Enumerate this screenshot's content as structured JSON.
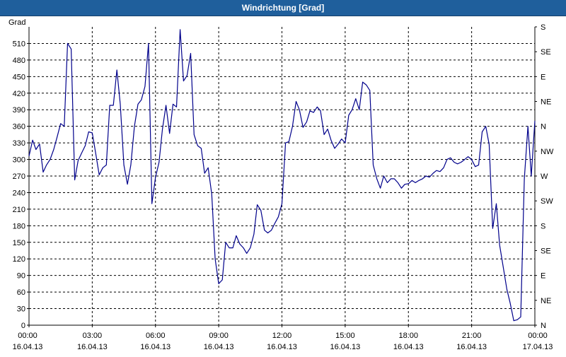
{
  "window": {
    "title": "Windrichtung [Grad]"
  },
  "colors": {
    "titlebar": "#1f5f9c",
    "line": "#00008b",
    "grid": "#000000"
  },
  "chart_data": {
    "type": "line",
    "title": "Windrichtung [Grad]",
    "ylabel": "Grad",
    "ylim": [
      0,
      540
    ],
    "xlim_hours": [
      0,
      24
    ],
    "grid": true,
    "y_ticks": [
      0,
      30,
      60,
      90,
      120,
      150,
      180,
      210,
      240,
      270,
      300,
      330,
      360,
      390,
      420,
      450,
      480,
      510
    ],
    "x_ticks": [
      {
        "hour": 0,
        "time": "00:00",
        "date": "16.04.13"
      },
      {
        "hour": 3,
        "time": "03:00",
        "date": "16.04.13"
      },
      {
        "hour": 6,
        "time": "06:00",
        "date": "16.04.13"
      },
      {
        "hour": 9,
        "time": "09:00",
        "date": "16.04.13"
      },
      {
        "hour": 12,
        "time": "12:00",
        "date": "16.04.13"
      },
      {
        "hour": 15,
        "time": "15:00",
        "date": "16.04.13"
      },
      {
        "hour": 18,
        "time": "18:00",
        "date": "16.04.13"
      },
      {
        "hour": 21,
        "time": "21:00",
        "date": "16.04.13"
      },
      {
        "hour": 24,
        "time": "00:00",
        "date": "17.04.13"
      }
    ],
    "right_axis": [
      {
        "value": 0,
        "label": "N"
      },
      {
        "value": 45,
        "label": "NE"
      },
      {
        "value": 90,
        "label": "E"
      },
      {
        "value": 135,
        "label": "SE"
      },
      {
        "value": 180,
        "label": "S"
      },
      {
        "value": 225,
        "label": "SW"
      },
      {
        "value": 270,
        "label": "W"
      },
      {
        "value": 315,
        "label": "NW"
      },
      {
        "value": 360,
        "label": "N"
      },
      {
        "value": 405,
        "label": "NE"
      },
      {
        "value": 450,
        "label": "E"
      },
      {
        "value": 495,
        "label": "SE"
      },
      {
        "value": 540,
        "label": "S"
      }
    ],
    "series": [
      {
        "x": [
          0,
          0.17,
          0.33,
          0.5,
          0.67,
          0.83,
          1.0,
          1.17,
          1.33,
          1.5,
          1.67,
          1.83,
          2.0,
          2.17,
          2.33,
          2.5,
          2.67,
          2.83,
          3.0,
          3.17,
          3.33,
          3.5,
          3.67,
          3.83,
          4.0,
          4.17,
          4.33,
          4.5,
          4.67,
          4.83,
          5.0,
          5.17,
          5.33,
          5.5,
          5.67,
          5.83,
          6.0,
          6.17,
          6.33,
          6.5,
          6.67,
          6.83,
          7.0,
          7.17,
          7.33,
          7.5,
          7.67,
          7.83,
          8.0,
          8.17,
          8.33,
          8.5,
          8.67,
          8.83,
          9.0,
          9.17,
          9.33,
          9.5,
          9.67,
          9.83,
          10.0,
          10.17,
          10.33,
          10.5,
          10.67,
          10.83,
          11.0,
          11.17,
          11.33,
          11.5,
          11.67,
          11.83,
          12.0,
          12.17,
          12.33,
          12.5,
          12.67,
          12.83,
          13.0,
          13.17,
          13.33,
          13.5,
          13.67,
          13.83,
          14.0,
          14.17,
          14.33,
          14.5,
          14.67,
          14.83,
          15.0,
          15.17,
          15.33,
          15.5,
          15.67,
          15.83,
          16.0,
          16.17,
          16.33,
          16.5,
          16.67,
          16.83,
          17.0,
          17.17,
          17.33,
          17.5,
          17.67,
          17.83,
          18.0,
          18.17,
          18.33,
          18.5,
          18.67,
          18.83,
          19.0,
          19.17,
          19.33,
          19.5,
          19.67,
          19.83,
          20.0,
          20.17,
          20.33,
          20.5,
          20.67,
          20.83,
          21.0,
          21.17,
          21.33,
          21.5,
          21.67,
          21.83,
          22.0,
          22.17,
          22.33,
          22.5,
          22.67,
          22.83,
          23.0,
          23.17,
          23.33,
          23.5,
          23.67,
          23.83,
          24.0
        ],
        "values": [
          306,
          335,
          318,
          328,
          277,
          290,
          300,
          318,
          340,
          365,
          360,
          510,
          500,
          263,
          298,
          312,
          325,
          350,
          348,
          310,
          272,
          285,
          290,
          398,
          398,
          462,
          400,
          290,
          255,
          290,
          360,
          400,
          408,
          432,
          510,
          220,
          268,
          295,
          355,
          398,
          347,
          400,
          395,
          535,
          442,
          452,
          492,
          345,
          325,
          320,
          275,
          285,
          237,
          120,
          75,
          82,
          150,
          140,
          140,
          162,
          147,
          140,
          130,
          140,
          165,
          218,
          208,
          172,
          167,
          172,
          185,
          196,
          220,
          330,
          332,
          360,
          405,
          390,
          358,
          368,
          388,
          385,
          395,
          388,
          345,
          355,
          335,
          320,
          328,
          337,
          330,
          380,
          390,
          410,
          390,
          440,
          435,
          425,
          290,
          265,
          248,
          270,
          258,
          265,
          265,
          258,
          248,
          255,
          256,
          262,
          258,
          262,
          265,
          270,
          268,
          275,
          280,
          278,
          285,
          300,
          303,
          295,
          292,
          295,
          300,
          305,
          300,
          287,
          290,
          350,
          360,
          327,
          175,
          220,
          145,
          105,
          65,
          40,
          8,
          10,
          15,
          265,
          360,
          270,
          370
        ]
      }
    ]
  }
}
